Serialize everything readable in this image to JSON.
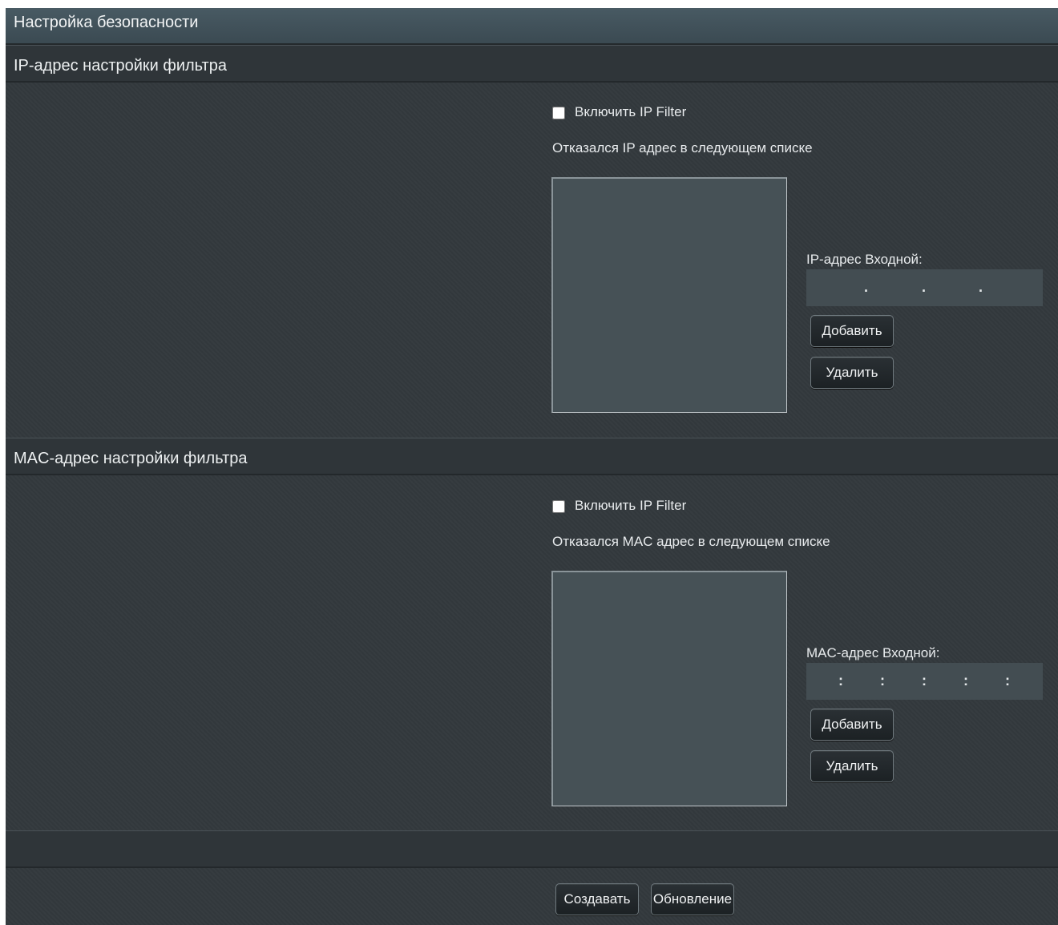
{
  "page": {
    "title": "Настройка безопасности"
  },
  "ip_filter": {
    "section_title": "IP-адрес настройки фильтра",
    "enable_label": "Включить IP Filter",
    "enabled": false,
    "list_caption": "Отказался IP адрес в следующем списке",
    "input_label": "IP-адрес Входной:",
    "separator": ".",
    "add_label": "Добавить",
    "delete_label": "Удалить"
  },
  "mac_filter": {
    "section_title": "MAC-адрес настройки фильтра",
    "enable_label": "Включить IP Filter",
    "enabled": false,
    "list_caption": "Отказался MAC адрес в следующем списке",
    "input_label": "MAC-адрес Входной:",
    "separator": ":",
    "add_label": "Добавить",
    "delete_label": "Удалить"
  },
  "footer": {
    "create_label": "Создавать",
    "refresh_label": "Обновление"
  }
}
